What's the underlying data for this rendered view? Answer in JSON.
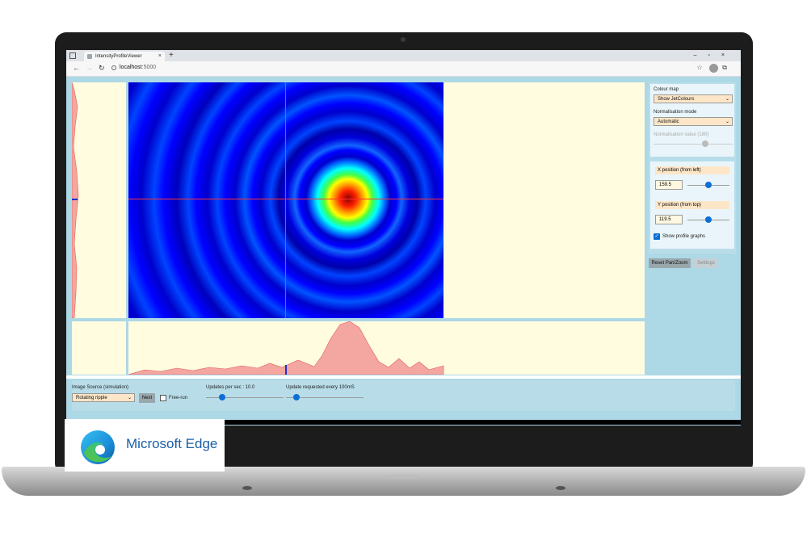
{
  "browser": {
    "tab_title": "IntensityProfileViewer",
    "tab_close": "×",
    "new_tab": "+",
    "url_host": "localhost",
    "url_port": ":5000",
    "window_controls": "–▫×"
  },
  "settings": {
    "colour_map_label": "Colour map",
    "colour_map_value": "Show JetColours",
    "normalisation_mode_label": "Normalisation mode",
    "normalisation_mode_value": "Automatic",
    "normalisation_value_label": "Normalisation value (180)",
    "x_position_label": "X position (from left)",
    "x_position_value": "159.5",
    "y_position_label": "Y position (from top)",
    "y_position_value": "119.5",
    "show_profile_graphs_label": "Show profile graphs",
    "show_profile_graphs_checked": true,
    "reset_button": "Reset Pan/Zoom",
    "settings_button": "Settings"
  },
  "controls": {
    "image_source_label": "Image Source (simulation)",
    "image_source_value": "Rotating ripple",
    "next_button": "Next",
    "free_run_label": "Free-run",
    "updates_per_sec_label": "Updates per sec : 10.0",
    "update_requested_label": "Update requested every 100mS"
  },
  "branding": {
    "product_name": "Microsoft Edge"
  },
  "colors": {
    "app_background": "#add8e6",
    "panel_background": "#fffce0",
    "profile_fill": "#f4a6a0",
    "accent": "#0b6fd6"
  }
}
